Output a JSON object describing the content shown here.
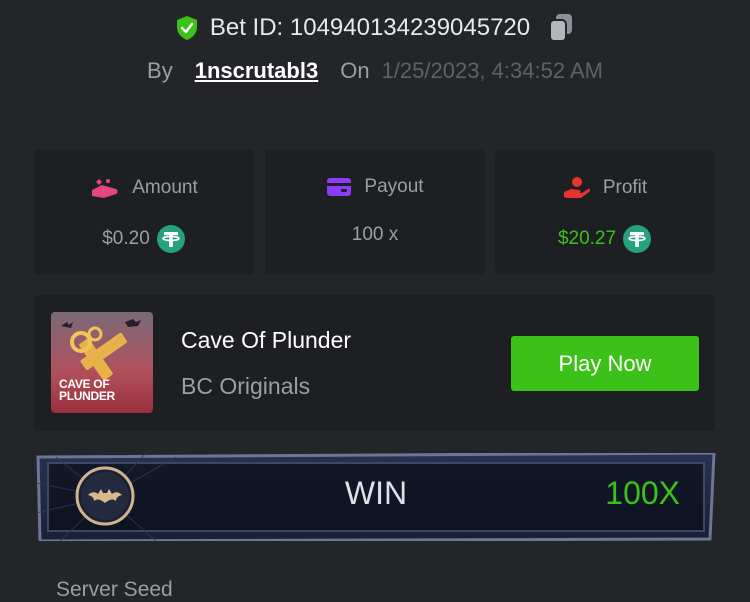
{
  "header": {
    "bet_id_label": "Bet ID: 104940134239045720",
    "by_label": "By",
    "username": "1nscrutabl3",
    "on_label": "On",
    "datetime": "1/25/2023, 4:34:52 AM"
  },
  "stats": [
    {
      "title": "Amount",
      "value": "$0.20",
      "icon": "amount-icon",
      "color": "#e6467f"
    },
    {
      "title": "Payout",
      "value": "100 x",
      "icon": "wallet-icon",
      "color": "#8b3cf6"
    },
    {
      "title": "Profit",
      "value": "$20.27",
      "icon": "profit-hand-icon",
      "color": "#e3342f"
    }
  ],
  "game": {
    "name": "Cave Of Plunder",
    "provider": "BC Originals",
    "thumb_text_line1": "CAVE OF",
    "thumb_text_line2": "PLUNDER",
    "play_label": "Play Now"
  },
  "result": {
    "label": "WIN",
    "multiplier": "100X"
  },
  "details": {
    "server_seed_label": "Server Seed"
  },
  "colors": {
    "background": "#232529",
    "card": "#1d1f23",
    "accent_green": "#3bc117",
    "muted_text": "#9b9ea3"
  }
}
